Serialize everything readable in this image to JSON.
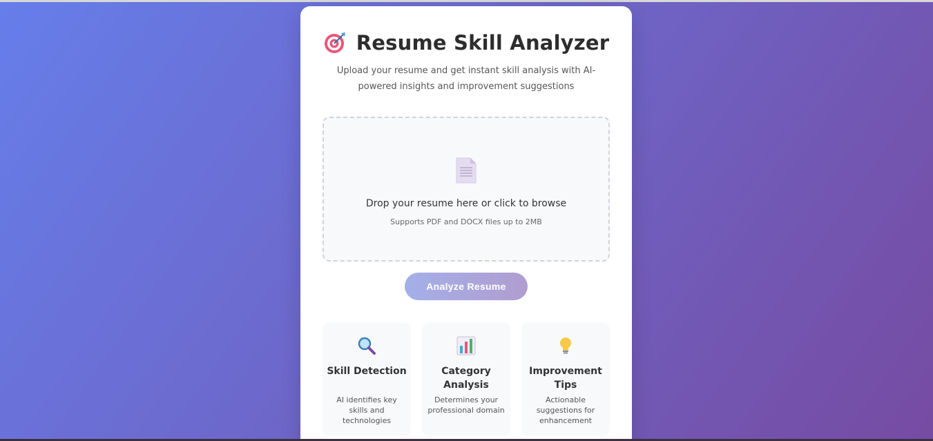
{
  "header": {
    "title": "Resume Skill Analyzer",
    "title_icon": "target-dart-icon",
    "subtitle": "Upload your resume and get instant skill analysis with AI-powered insights and improvement suggestions"
  },
  "upload": {
    "icon": "document-icon",
    "prompt": "Drop your resume here or click to browse",
    "hint": "Supports PDF and DOCX files up to 2MB"
  },
  "actions": {
    "analyze_label": "Analyze Resume"
  },
  "features": [
    {
      "icon": "magnifier-icon",
      "title": "Skill Detection",
      "description": "AI identifies key skills and technologies"
    },
    {
      "icon": "bar-chart-icon",
      "title": "Category Analysis",
      "description": "Determines your professional domain"
    },
    {
      "icon": "lightbulb-icon",
      "title": "Improvement Tips",
      "description": "Actionable suggestions for enhancement"
    }
  ],
  "colors": {
    "background_start": "#667eea",
    "background_end": "#764ba2",
    "button_start": "#a4afe8",
    "button_end": "#b19dd0"
  }
}
